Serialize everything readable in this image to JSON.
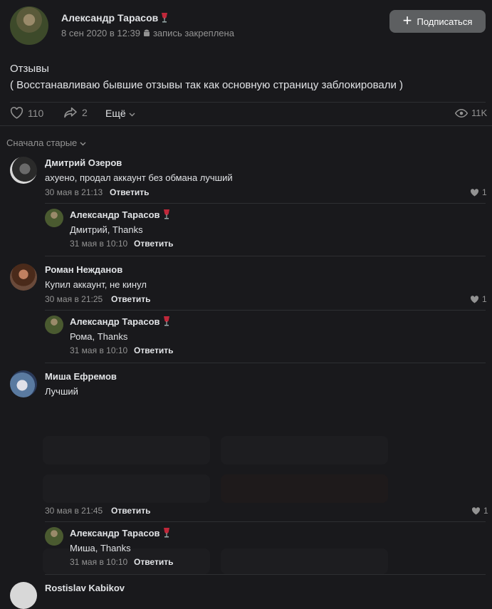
{
  "post": {
    "author": "Александр Тарасов",
    "date": "8 сен 2020 в 12:39",
    "pinned": "запись закреплена",
    "subscribe": "Подписаться",
    "title": "Отзывы",
    "text": "( Восстанавливаю бывшие отзывы так как основную страницу заблокировали )",
    "likes": "110",
    "shares": "2",
    "more": "Ещё",
    "views": "11K"
  },
  "sort_label": "Сначала старые",
  "comments": [
    {
      "name": "Дмитрий Озеров",
      "text": "ахуено, продал аккаунт без обмана лучший",
      "date": "30 мая в 21:13",
      "reply_label": "Ответить",
      "likes": "1",
      "reply": {
        "name": "Александр Тарасов",
        "text": "Дмитрий, Thanks",
        "date": "31 мая в 10:10",
        "reply_label": "Ответить"
      }
    },
    {
      "name": "Роман Нежданов",
      "text": "Купил аккаунт, не кинул",
      "date": "30 мая в 21:25",
      "reply_label": "Ответить",
      "likes": "1",
      "reply": {
        "name": "Александр Тарасов",
        "text": "Рома, Thanks",
        "date": "31 мая в 10:10",
        "reply_label": "Ответить"
      }
    },
    {
      "name": "Миша Ефремов",
      "text": "Лучший",
      "date": "30 мая в 21:45",
      "reply_label": "Ответить",
      "likes": "1",
      "reply": {
        "name": "Александр Тарасов",
        "text": "Миша, Thanks",
        "date": "31 мая в 10:10",
        "reply_label": "Ответить"
      }
    },
    {
      "name": "Rostislav  Kabikov"
    }
  ],
  "colors": {
    "background": "#19191c",
    "secondary_text": "#939393",
    "button": "#5d5f61",
    "separator": "#2e2f32"
  }
}
